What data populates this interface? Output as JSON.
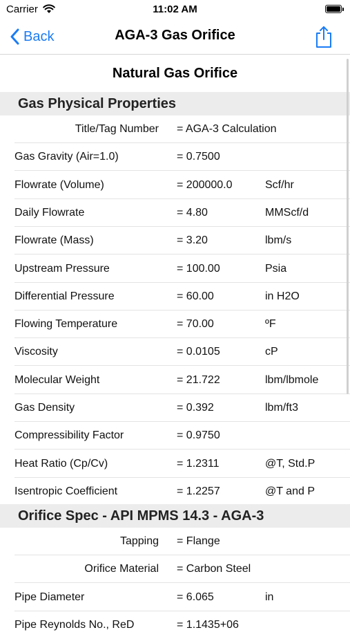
{
  "status_bar": {
    "carrier": "Carrier",
    "time": "11:02 AM"
  },
  "nav": {
    "back_label": "Back",
    "title": "AGA-3 Gas Orifice"
  },
  "page_title": "Natural Gas Orifice",
  "sections": [
    {
      "title": "Gas Physical Properties",
      "rows": [
        {
          "label": "Title/Tag Number",
          "value": "= AGA-3 Calculation",
          "unit": "",
          "align": "right"
        },
        {
          "label": "Gas Gravity (Air=1.0)",
          "value": "= 0.7500",
          "unit": ""
        },
        {
          "label": "Flowrate (Volume)",
          "value": "= 200000.0",
          "unit": "Scf/hr"
        },
        {
          "label": "Daily Flowrate",
          "value": "= 4.80",
          "unit": "MMScf/d"
        },
        {
          "label": "Flowrate (Mass)",
          "value": "= 3.20",
          "unit": "lbm/s"
        },
        {
          "label": "Upstream Pressure",
          "value": "= 100.00",
          "unit": "Psia"
        },
        {
          "label": "Differential Pressure",
          "value": "= 60.00",
          "unit": "in H2O"
        },
        {
          "label": "Flowing Temperature",
          "value": "= 70.00",
          "unit": "ºF"
        },
        {
          "label": "Viscosity",
          "value": "= 0.0105",
          "unit": "cP"
        },
        {
          "label": "Molecular Weight",
          "value": "= 21.722",
          "unit": "lbm/lbmole"
        },
        {
          "label": "Gas Density",
          "value": "= 0.392",
          "unit": "lbm/ft3"
        },
        {
          "label": "Compressibility Factor",
          "value": "= 0.9750",
          "unit": ""
        },
        {
          "label": "Heat Ratio (Cp/Cv)",
          "value": "= 1.2311",
          "unit": "@T, Std.P"
        },
        {
          "label": "Isentropic Coefficient",
          "value": "= 1.2257",
          "unit": "@T and P"
        }
      ]
    },
    {
      "title": "Orifice Spec - API MPMS 14.3 - AGA-3",
      "rows": [
        {
          "label": "Tapping",
          "value": "= Flange",
          "unit": "",
          "align": "right"
        },
        {
          "label": "Orifice Material",
          "value": "= Carbon Steel",
          "unit": "",
          "align": "right"
        },
        {
          "label": "Pipe Diameter",
          "value": "= 6.065",
          "unit": "in"
        },
        {
          "label": "Pipe Reynolds No., ReD",
          "value": "= 1.1435+06",
          "unit": ""
        }
      ]
    }
  ]
}
